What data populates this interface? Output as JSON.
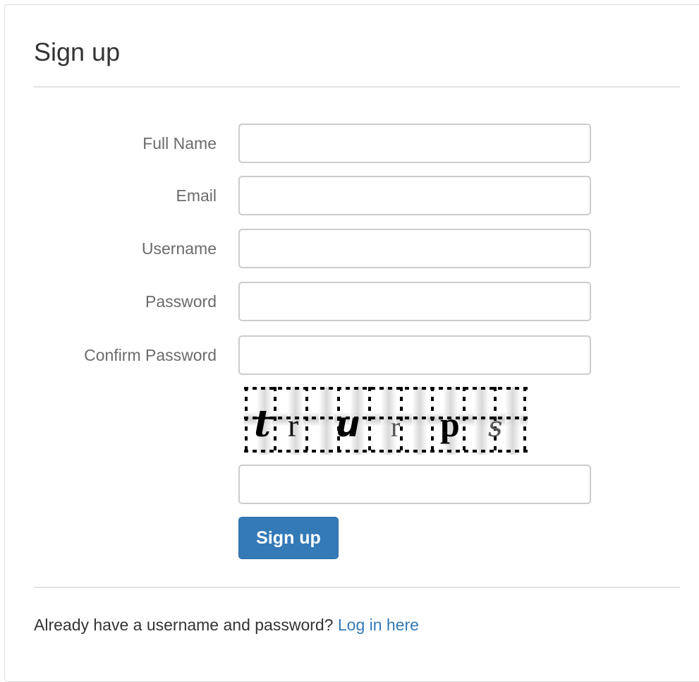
{
  "page": {
    "title": "Sign up"
  },
  "form": {
    "fields": [
      {
        "label": "Full Name",
        "value": "",
        "placeholder": ""
      },
      {
        "label": "Email",
        "value": "",
        "placeholder": ""
      },
      {
        "label": "Username",
        "value": "",
        "placeholder": ""
      },
      {
        "label": "Password",
        "value": "",
        "placeholder": ""
      },
      {
        "label": "Confirm Password",
        "value": "",
        "placeholder": ""
      }
    ],
    "captcha": {
      "characters": [
        "t",
        "r",
        "u",
        "r",
        "p",
        "s"
      ],
      "input_value": ""
    },
    "submit_label": "Sign up"
  },
  "footer": {
    "prompt": "Already have a username and password?",
    "link_text": "Log in here"
  },
  "colors": {
    "primary_button": "#337ab7",
    "link": "#337ab7",
    "label_text": "#6b6b6b",
    "input_border": "#cccccc",
    "divider": "#e3e3e3"
  }
}
